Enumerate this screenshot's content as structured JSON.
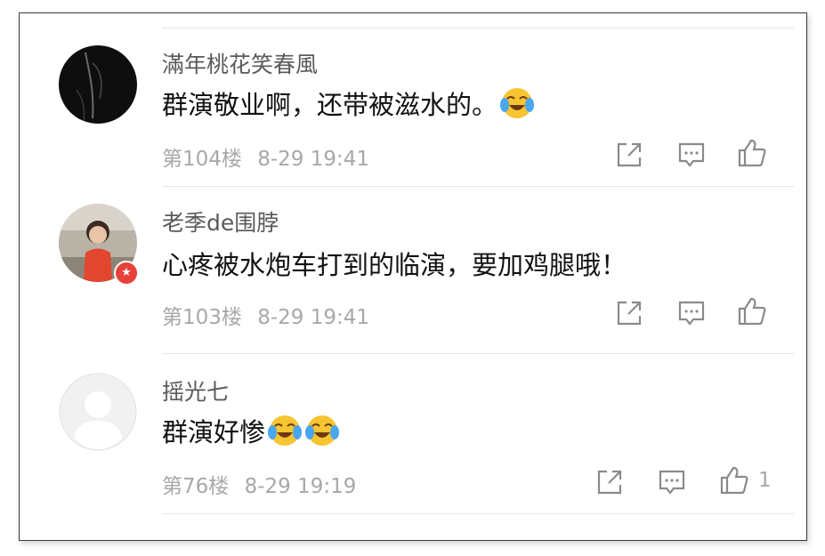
{
  "comments": [
    {
      "username": "滿年桃花笑春風",
      "text": "群演敬业啊，还带被滋水的。",
      "emoji": "laughing-crying-emoji",
      "emoji_count": 1,
      "floor": "第104楼",
      "time": "8-29 19:41",
      "like_count": ""
    },
    {
      "username": "老季de围脖",
      "text": "心疼被水炮车打到的临演，要加鸡腿哦！",
      "emoji": "",
      "emoji_count": 0,
      "floor": "第103楼",
      "time": "8-29 19:41",
      "like_count": ""
    },
    {
      "username": "摇光七",
      "text": "群演好惨",
      "emoji": "laughing-crying-emoji",
      "emoji_count": 2,
      "floor": "第76楼",
      "time": "8-29 19:19",
      "like_count": "1"
    }
  ],
  "icons": {
    "share": "share-icon",
    "reply": "comment-icon",
    "like": "thumbs-up-icon",
    "vip": "star-icon"
  },
  "colors": {
    "username": "#5a5a5a",
    "text": "#111111",
    "meta": "#a8a8a8",
    "divider": "#e6e6e6",
    "vip_badge": "#e8413a"
  }
}
